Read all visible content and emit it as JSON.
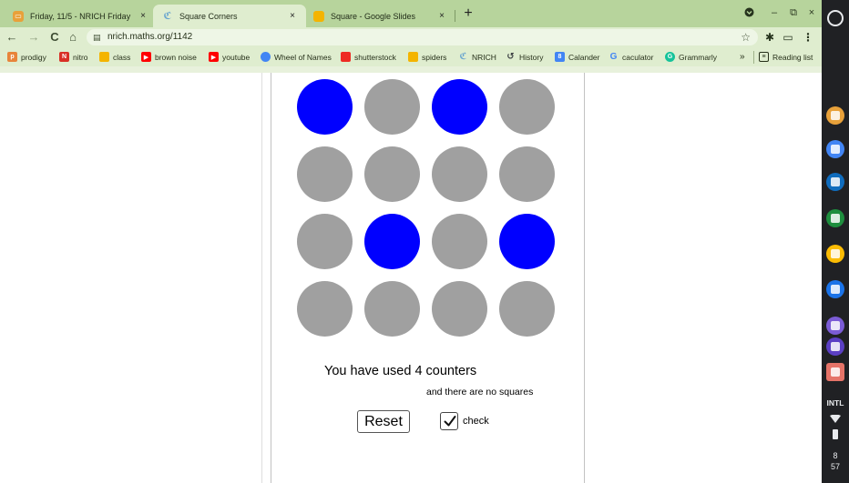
{
  "browser": {
    "tabs": [
      {
        "title": "Friday, 11/5 - NRICH Friday",
        "icon": "calendar-icon",
        "color": "#e8a13a",
        "active": false
      },
      {
        "title": "Square Corners",
        "icon": "nrich-icon",
        "color": "#6aa6cf",
        "active": true
      },
      {
        "title": "Square - Google Slides",
        "icon": "slides-icon",
        "color": "#f4b400",
        "active": false
      }
    ],
    "tab_close_glyph": "×",
    "new_tab_glyph": "+",
    "url": "nrich.maths.org/1142",
    "bookmarks": [
      {
        "label": "prodigy",
        "icon": "prodigy-icon",
        "color": "#e8843a"
      },
      {
        "label": "nitro",
        "icon": "nitro-icon",
        "color": "#d93025"
      },
      {
        "label": "class",
        "icon": "classroom-icon",
        "color": "#f4b400"
      },
      {
        "label": "brown noise",
        "icon": "youtube-icon",
        "color": "#ff0000"
      },
      {
        "label": "youtube",
        "icon": "youtube-icon",
        "color": "#ff0000"
      },
      {
        "label": "Wheel of Names",
        "icon": "wheel-icon",
        "color": "#4285f4"
      },
      {
        "label": "shutterstock",
        "icon": "shutterstock-icon",
        "color": "#ee2b24"
      },
      {
        "label": "spiders",
        "icon": "folder-icon",
        "color": "#f4b400"
      },
      {
        "label": "NRICH",
        "icon": "nrich-icon",
        "color": "#6aa6cf"
      },
      {
        "label": "History",
        "icon": "history-icon",
        "color": "#3c4043"
      },
      {
        "label": "Calander",
        "icon": "calendar-icon",
        "color": "#4285f4"
      },
      {
        "label": "caculator",
        "icon": "google-icon",
        "color": "#4285f4"
      },
      {
        "label": "Grammarly",
        "icon": "grammarly-icon",
        "color": "#15c39a"
      }
    ],
    "overflow_glyph": "»",
    "reading_list": "Reading list"
  },
  "game": {
    "counters": [
      "blue",
      "grey",
      "blue",
      "grey",
      "grey",
      "grey",
      "grey",
      "grey",
      "grey",
      "blue",
      "grey",
      "blue",
      "grey",
      "grey",
      "grey",
      "grey"
    ],
    "colors": {
      "blue": "#0000ff",
      "grey": "#a0a0a0"
    },
    "status_text": "You have used 4 counters",
    "squares_text": "and there are no squares",
    "reset_label": "Reset",
    "check_label": "check",
    "check_checked": true
  },
  "shelf": {
    "apps": [
      {
        "icon": "chrome-icon",
        "color": "#e8a13a"
      },
      {
        "icon": "google-calendar-icon",
        "color": "#4285f4"
      },
      {
        "icon": "outlook-icon",
        "color": "#0f6cbd"
      },
      {
        "icon": "google-classroom-icon",
        "color": "#1e8e3e"
      },
      {
        "icon": "notes-icon",
        "color": "#fbbc04"
      },
      {
        "icon": "camera-icon",
        "color": "#1a73e8"
      },
      {
        "icon": "dots-app-icon",
        "color": "#7b5cd6"
      },
      {
        "icon": "dots-app-2-icon",
        "color": "#5b3fc4"
      },
      {
        "icon": "exit-app-icon",
        "color": "#e57368"
      }
    ],
    "ime": "INTL",
    "clock_hour": "8",
    "clock_minute": "57"
  }
}
